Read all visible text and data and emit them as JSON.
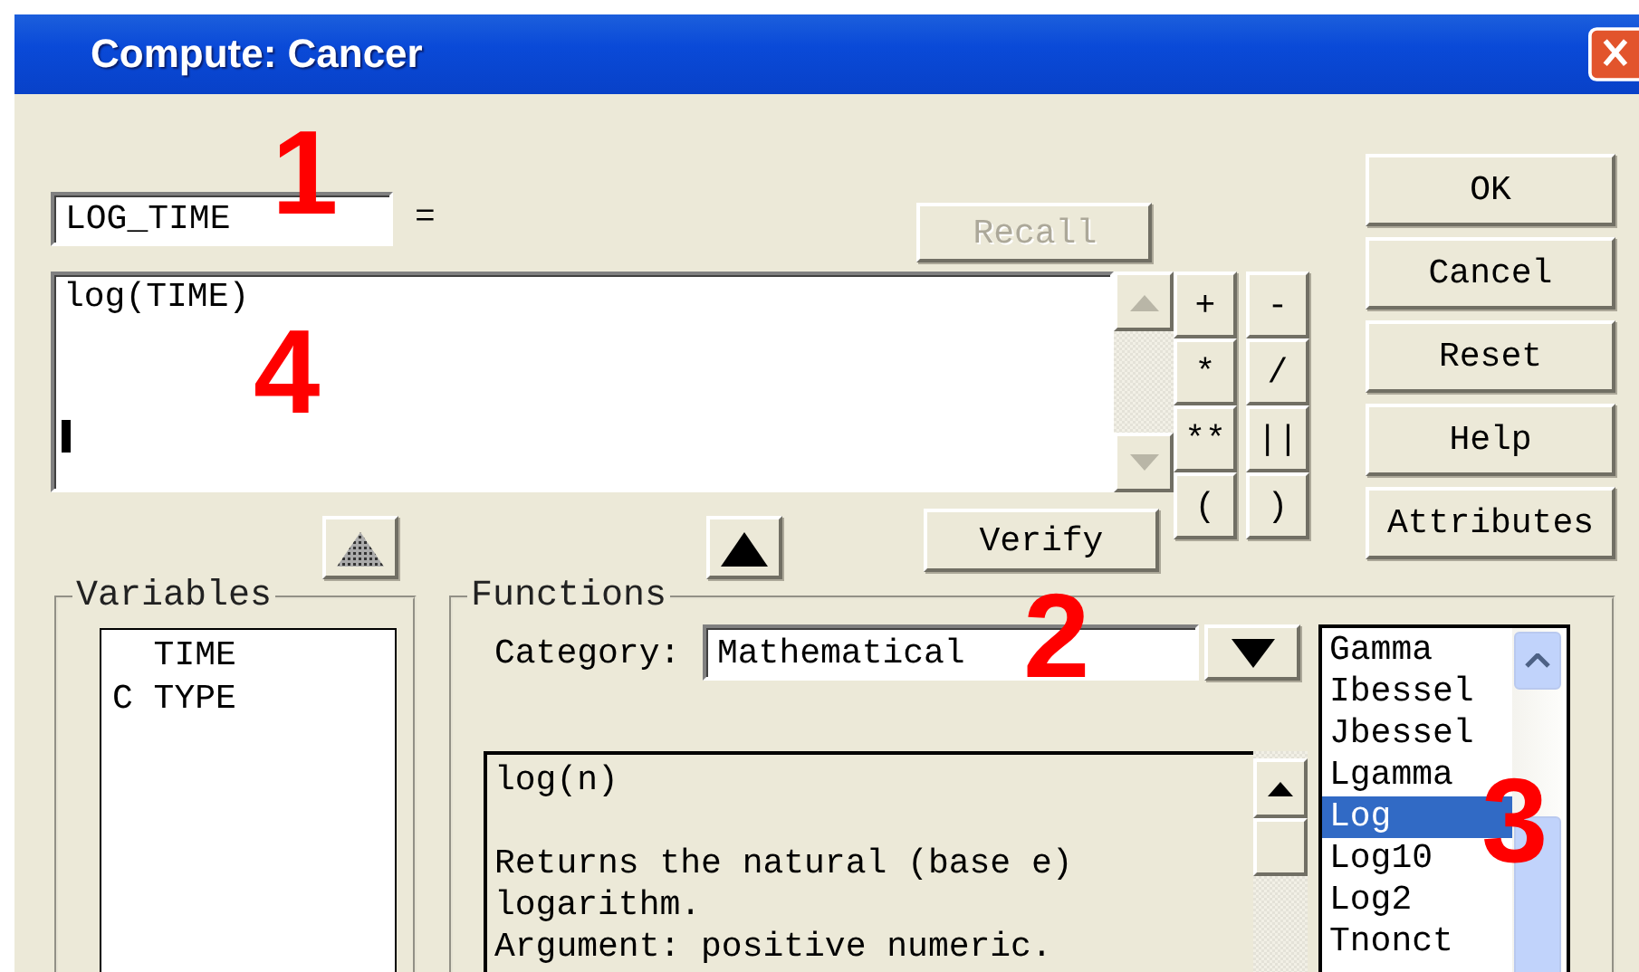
{
  "window": {
    "title": "Compute: Cancer"
  },
  "target": {
    "value": "LOG_TIME",
    "equals": "="
  },
  "recall": {
    "label": "Recall",
    "disabled": true
  },
  "expression": {
    "value": "log(TIME)"
  },
  "operators": [
    "+",
    "-",
    "*",
    "/",
    "**",
    "||",
    "(",
    ")"
  ],
  "verify": {
    "label": "Verify"
  },
  "paste_buttons": [
    {
      "disabled": true
    },
    {
      "disabled": false
    }
  ],
  "buttons": [
    "OK",
    "Cancel",
    "Reset",
    "Help",
    "Attributes"
  ],
  "variables": {
    "title": "Variables",
    "items": [
      {
        "name": "TIME"
      },
      {
        "prefix": "C",
        "name": "TYPE"
      }
    ]
  },
  "functions": {
    "title": "Functions",
    "category_label": "Category:",
    "category": "Mathematical",
    "signature": "log(n)",
    "description": [
      "Returns the natural (base e)",
      "logarithm.",
      "Argument: positive numeric."
    ],
    "items": [
      {
        "label": "Gamma",
        "selected": false
      },
      {
        "label": "Ibessel",
        "selected": false
      },
      {
        "label": "Jbessel",
        "selected": false
      },
      {
        "label": "Lgamma",
        "selected": false
      },
      {
        "label": "Log",
        "selected": true
      },
      {
        "label": "Log10",
        "selected": false
      },
      {
        "label": "Log2",
        "selected": false
      },
      {
        "label": "Tnonct",
        "selected": false
      }
    ]
  },
  "annotations": [
    "1",
    "2",
    "3",
    "4"
  ]
}
